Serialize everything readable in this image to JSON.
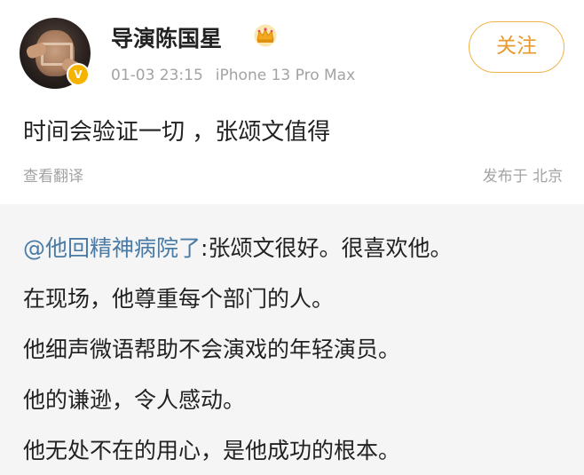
{
  "post": {
    "author": {
      "name": "导演陈国星",
      "verified_badge": "V",
      "crown_icon": "crown-icon",
      "avatar_icon": "avatar"
    },
    "meta": {
      "time": "01-03 23:15",
      "device": "iPhone 13 Pro Max"
    },
    "follow_label": "关注",
    "content": "时间会验证一切 ，张颂文值得",
    "translate_label": "查看翻译",
    "location_label": "发布于 北京"
  },
  "repost": {
    "mention": "@他回精神病院了",
    "line1_rest": ":张颂文很好。很喜欢他。",
    "lines": [
      "在现场，他尊重每个部门的人。",
      "他细声微语帮助不会演戏的年轻演员。",
      "他的谦逊，令人感动。",
      "他无处不在的用心，是他成功的根本。"
    ]
  },
  "colors": {
    "accent_orange": "#e9992c",
    "follow_border": "#f1b24a",
    "mention_blue": "#4a7ba6",
    "meta_gray": "#a3a3a3",
    "repost_bg": "#f5f5f5",
    "badge_gold": "#f5b400"
  }
}
